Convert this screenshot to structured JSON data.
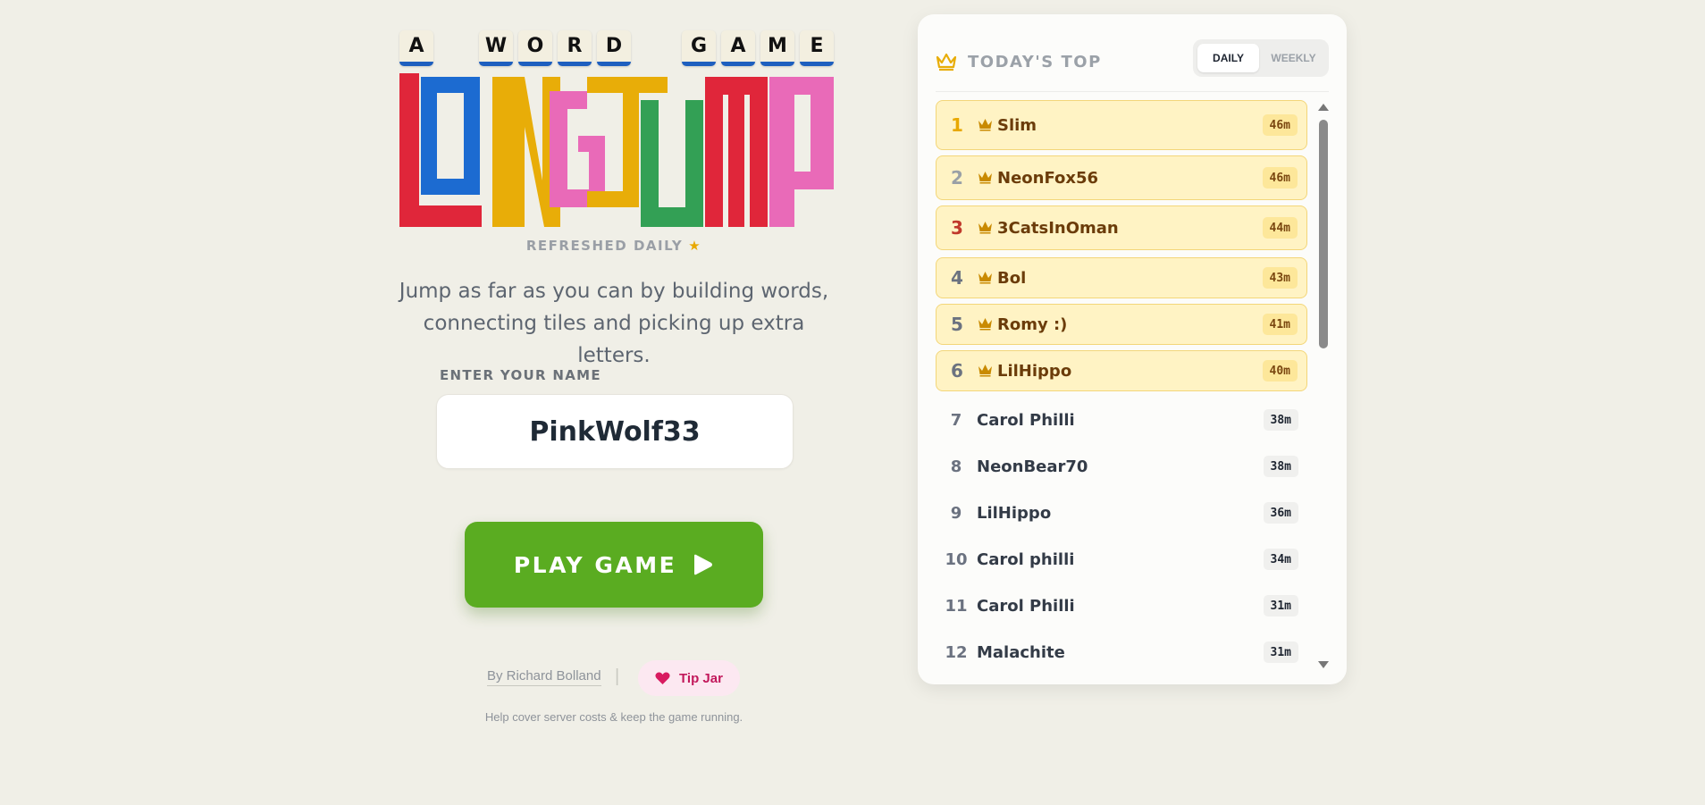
{
  "header": {
    "tiles": [
      "A",
      "W",
      "O",
      "R",
      "D",
      "G",
      "A",
      "M",
      "E"
    ],
    "logo_text": "LONGJUMP",
    "refreshed": "REFRESHED DAILY",
    "tagline_line1": "Jump as far as you can by building words,",
    "tagline_line2": "connecting tiles and picking up extra letters."
  },
  "form": {
    "name_label": "ENTER YOUR NAME",
    "name_value": "PinkWolf33",
    "play_label": "PLAY GAME"
  },
  "footer": {
    "byline": "By Richard Bolland",
    "separator": "|",
    "tip_label": "Tip Jar",
    "help_text": "Help cover server costs & keep the game running."
  },
  "leaderboard": {
    "title": "TODAY'S TOP",
    "tabs": [
      "DAILY",
      "WEEKLY"
    ],
    "active_tab": "DAILY",
    "rows": [
      {
        "rank": "1",
        "name": "Slim",
        "score": "46m",
        "crowned": true
      },
      {
        "rank": "2",
        "name": "NeonFox56",
        "score": "46m",
        "crowned": true
      },
      {
        "rank": "3",
        "name": "3CatsInOman",
        "score": "44m",
        "crowned": true
      },
      {
        "rank": "4",
        "name": "Bol",
        "score": "43m",
        "crowned": true
      },
      {
        "rank": "5",
        "name": "Romy :)",
        "score": "41m",
        "crowned": true
      },
      {
        "rank": "6",
        "name": "LilHippo",
        "score": "40m",
        "crowned": true
      },
      {
        "rank": "7",
        "name": "Carol Philli",
        "score": "38m",
        "crowned": false
      },
      {
        "rank": "8",
        "name": "NeonBear70",
        "score": "38m",
        "crowned": false
      },
      {
        "rank": "9",
        "name": "LilHippo",
        "score": "36m",
        "crowned": false
      },
      {
        "rank": "10",
        "name": "Carol philli",
        "score": "34m",
        "crowned": false
      },
      {
        "rank": "11",
        "name": "Carol Philli",
        "score": "31m",
        "crowned": false
      },
      {
        "rank": "12",
        "name": "Malachite",
        "score": "31m",
        "crowned": false
      }
    ]
  },
  "colors": {
    "background": "#f0efe7",
    "play_button": "#5aac21",
    "gold_rank": "#e8a800",
    "silver_rank": "#9aa0a6",
    "bronze_rank": "#c0392b",
    "crown": "#c98a00",
    "tip": "#c2185b",
    "logo": [
      "#e0263a",
      "#1c6bd1",
      "#e8ad08",
      "#e96ab8",
      "#33a055"
    ]
  },
  "icons": {
    "star": "star-icon",
    "play": "play-icon",
    "heart": "heart-icon",
    "crown": "crown-icon"
  }
}
